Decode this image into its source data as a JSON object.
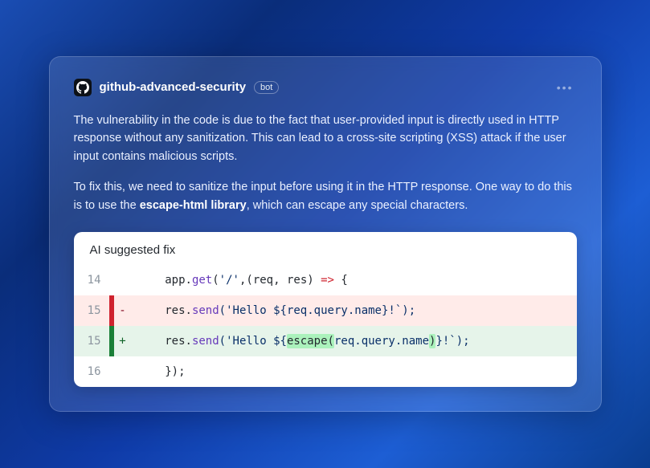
{
  "comment": {
    "author": "github-advanced-security",
    "bot_badge": "bot",
    "paragraph1": "The vulnerability in the code is due to the fact that user-provided input is directly used in HTTP response without any sanitization. This can lead to a cross-site scripting (XSS) attack if the user input contains malicious scripts.",
    "paragraph2_pre": "To fix this, we need to sanitize the input before using it in the HTTP response. One way to do this is to use the ",
    "paragraph2_strong": "escape-html library",
    "paragraph2_post": ", which can escape any special characters."
  },
  "suggestion": {
    "title": "AI suggested fix",
    "lines": [
      {
        "num": "14",
        "kind": "ctx",
        "tokens": [
          {
            "t": "    app.",
            "c": "punc"
          },
          {
            "t": "get",
            "c": "fn"
          },
          {
            "t": "(",
            "c": "punc"
          },
          {
            "t": "'/'",
            "c": "str"
          },
          {
            "t": ",(req, res) ",
            "c": "punc"
          },
          {
            "t": "=>",
            "c": "arrow"
          },
          {
            "t": " {",
            "c": "punc"
          }
        ]
      },
      {
        "num": "15",
        "kind": "del",
        "tokens": [
          {
            "t": "    res.",
            "c": "punc"
          },
          {
            "t": "send",
            "c": "fn"
          },
          {
            "t": "('Hello ${req.",
            "c": "str"
          },
          {
            "t": "query",
            "c": "prop"
          },
          {
            "t": ".",
            "c": "str"
          },
          {
            "t": "name",
            "c": "prop"
          },
          {
            "t": "}!`);",
            "c": "str"
          }
        ]
      },
      {
        "num": "15",
        "kind": "add",
        "tokens": [
          {
            "t": "    res.",
            "c": "punc"
          },
          {
            "t": "send",
            "c": "fn"
          },
          {
            "t": "('Hello ${",
            "c": "str"
          },
          {
            "t": "escape(",
            "c": "punc",
            "hl": true
          },
          {
            "t": "req.",
            "c": "str"
          },
          {
            "t": "query",
            "c": "prop"
          },
          {
            "t": ".",
            "c": "str"
          },
          {
            "t": "name",
            "c": "prop"
          },
          {
            "t": ")",
            "c": "punc",
            "hl": true
          },
          {
            "t": "}!`);",
            "c": "str"
          }
        ]
      },
      {
        "num": "16",
        "kind": "ctx",
        "tokens": [
          {
            "t": "    });",
            "c": "punc"
          }
        ]
      }
    ]
  }
}
